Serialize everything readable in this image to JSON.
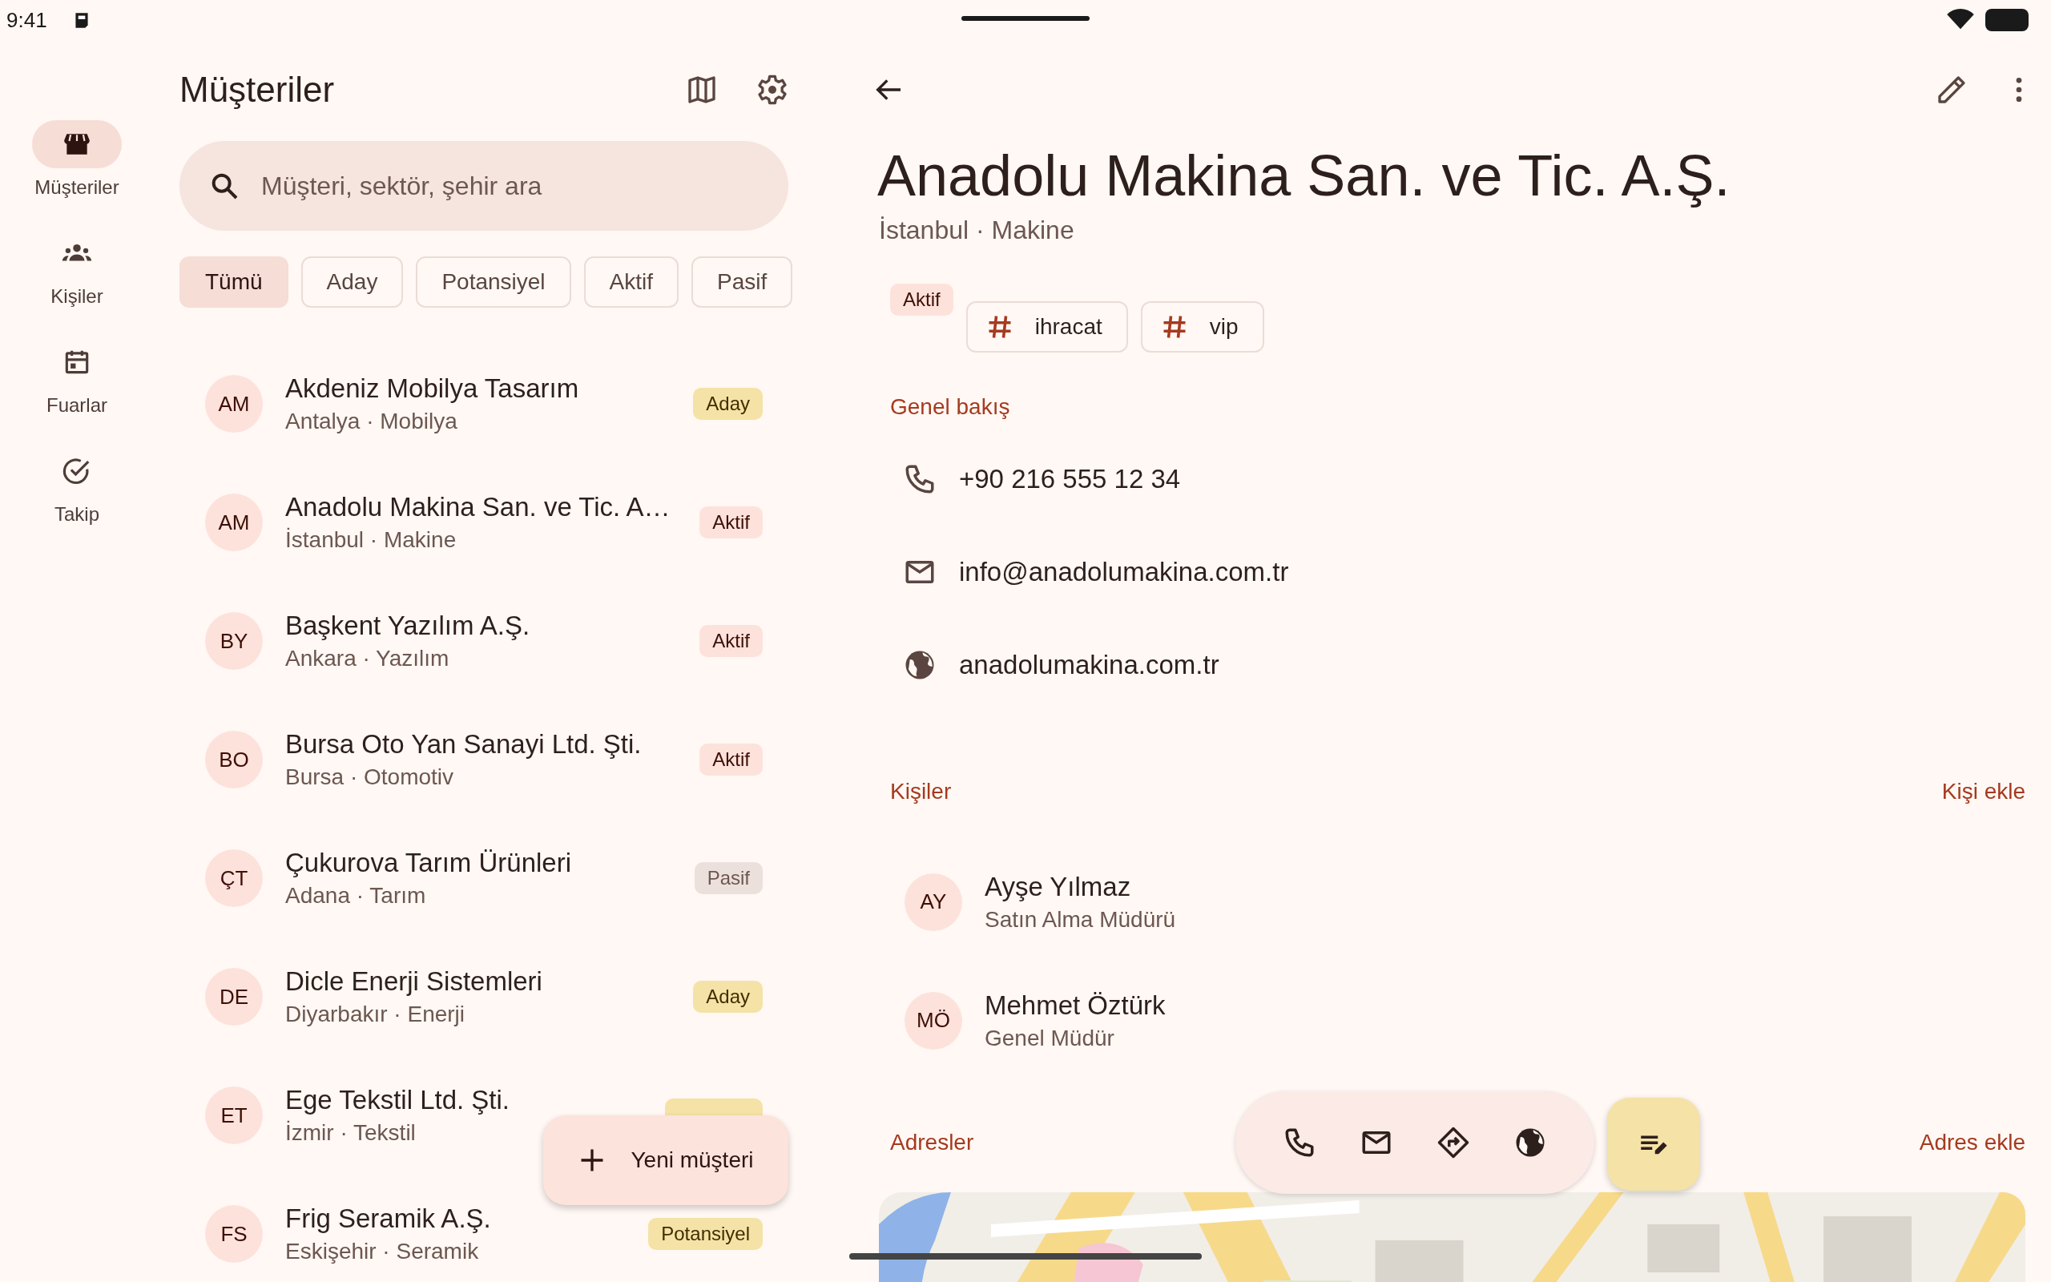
{
  "status_bar": {
    "time": "9:41"
  },
  "rail": [
    {
      "label": "Müşteriler",
      "kind": "store",
      "selected": true
    },
    {
      "label": "Kişiler",
      "kind": "people",
      "selected": false
    },
    {
      "label": "Fuarlar",
      "kind": "calendar",
      "selected": false
    },
    {
      "label": "Takip",
      "kind": "check",
      "selected": false
    }
  ],
  "list": {
    "title": "Müşteriler",
    "search": {
      "placeholder": "Müşteri, sektör, şehir ara"
    },
    "filters": [
      {
        "label": "Tümü",
        "selected": true
      },
      {
        "label": "Aday",
        "selected": false
      },
      {
        "label": "Potansiyel",
        "selected": false
      },
      {
        "label": "Aktif",
        "selected": false
      },
      {
        "label": "Pasif",
        "selected": false
      }
    ],
    "rows": [
      {
        "initials": "AM",
        "name": "Akdeniz Mobilya Tasarım",
        "subtitle": "Antalya · Mobilya",
        "kind": "aday",
        "badge": "Aday"
      },
      {
        "initials": "AM",
        "name": "Anadolu Makina San. ve Tic. A…",
        "subtitle": "İstanbul · Makine",
        "kind": "aktif",
        "badge": "Aktif"
      },
      {
        "initials": "BY",
        "name": "Başkent Yazılım A.Ş.",
        "subtitle": "Ankara · Yazılım",
        "kind": "aktif",
        "badge": "Aktif"
      },
      {
        "initials": "BO",
        "name": "Bursa Oto Yan Sanayi Ltd. Şti.",
        "subtitle": "Bursa · Otomotiv",
        "kind": "aktif",
        "badge": "Aktif"
      },
      {
        "initials": "ÇT",
        "name": "Çukurova Tarım Ürünleri",
        "subtitle": "Adana · Tarım",
        "kind": "pasif",
        "badge": "Pasif"
      },
      {
        "initials": "DE",
        "name": "Dicle Enerji Sistemleri",
        "subtitle": "Diyarbakır · Enerji",
        "kind": "aday",
        "badge": "Aday"
      },
      {
        "initials": "ET",
        "name": "Ege Tekstil Ltd. Şti.",
        "subtitle": "İzmir · Tekstil",
        "kind": "potansiyel"
      },
      {
        "initials": "FS",
        "name": "Frig Seramik A.Ş.",
        "subtitle": "Eskişehir · Seramik",
        "kind": "potansiyel",
        "badge": "Potansiyel"
      }
    ],
    "fab": {
      "label": "Yeni müşteri"
    }
  },
  "detail": {
    "title": "Anadolu Makina San. ve Tic. A.Ş.",
    "subtitle": "İstanbul · Makine",
    "status": {
      "kind": "aktif",
      "label": "Aktif"
    },
    "tags": [
      "ihracat",
      "vip"
    ],
    "overview": {
      "heading": "Genel bakış",
      "items": [
        {
          "kind": "phone",
          "text": "+90 216 555 12 34"
        },
        {
          "kind": "mail",
          "text": "info@anadolumakina.com.tr"
        },
        {
          "kind": "web",
          "text": "anadolumakina.com.tr"
        }
      ]
    },
    "contacts": {
      "heading": "Kişiler",
      "action": "Kişi ekle",
      "people": [
        {
          "initials": "AY",
          "name": "Ayşe Yılmaz",
          "role": "Satın Alma Müdürü"
        },
        {
          "initials": "MÖ",
          "name": "Mehmet Öztürk",
          "role": "Genel Müdür"
        }
      ]
    },
    "addresses": {
      "heading": "Adresler",
      "action": "Adres ekle"
    },
    "toolbar": [
      {
        "kind": "phone"
      },
      {
        "kind": "mail"
      },
      {
        "kind": "directions"
      },
      {
        "kind": "web"
      }
    ],
    "note_button": {
      "kind": "note"
    }
  }
}
